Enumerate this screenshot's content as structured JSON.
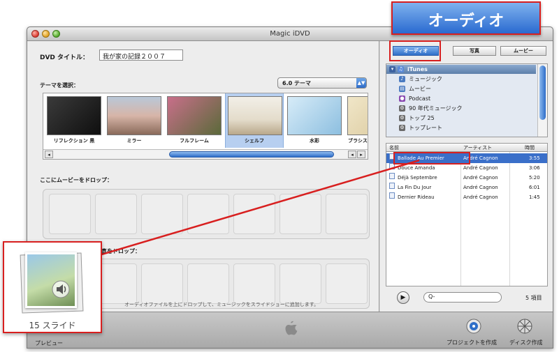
{
  "window": {
    "title": "Magic iDVD"
  },
  "left_pane": {
    "dvd_title_label": "DVD タイトル：",
    "dvd_title_value": "我が家の記録２００７",
    "theme_label": "テーマを選択：",
    "theme_select_value": "6.0 テーマ",
    "themes": [
      {
        "name": "リフレクション 黒"
      },
      {
        "name": "ミラー"
      },
      {
        "name": "フルフレーム"
      },
      {
        "name": "シェルフ"
      },
      {
        "name": "水彩"
      },
      {
        "name": "ブラシス"
      }
    ],
    "movie_drop_label": "ここにムービーをドロップ：",
    "photo_drop_label": "ここに写真をドロップ：",
    "audio_hint": "オーディオファイルを上にドロップして、ミュージックをスライドショーに追加します。"
  },
  "right_pane": {
    "tabs": [
      {
        "label": "オーディオ"
      },
      {
        "label": "写真"
      },
      {
        "label": "ムービー"
      }
    ],
    "sources": [
      {
        "label": "iTunes"
      },
      {
        "label": "ミュージック"
      },
      {
        "label": "ムービー"
      },
      {
        "label": "Podcast"
      },
      {
        "label": "90 年代ミュージック"
      },
      {
        "label": "トップ 25"
      },
      {
        "label": "トップレート"
      }
    ],
    "table": {
      "headers": {
        "name": "名前",
        "artist": "アーティスト",
        "time": "時間"
      },
      "rows": [
        {
          "name": "Ballade Au Premier",
          "artist": "André Cagnon",
          "time": "3:55"
        },
        {
          "name": "Douce Amanda",
          "artist": "André Cagnon",
          "time": "3:06"
        },
        {
          "name": "Déjà Septembre",
          "artist": "André Cagnon",
          "time": "5:20"
        },
        {
          "name": "La Fin Du Jour",
          "artist": "André Cagnon",
          "time": "6:01"
        },
        {
          "name": "Dernier Rideau",
          "artist": "André Cagnon",
          "time": "1:45"
        }
      ]
    },
    "search_placeholder": "Q-",
    "item_count": "5 項目"
  },
  "bottom_bar": {
    "preview_label": "プレビュー",
    "burn_project_label": "プロジェクトを作成",
    "burn_disc_label": "ディスク作成"
  },
  "callouts": {
    "audio_tab_big": "オーディオ",
    "slide_count": "15 スライド"
  },
  "colors": {
    "accent_blue": "#2f6fc8",
    "highlight_red": "#d81f1f",
    "selection_blue": "#3a6fc9"
  }
}
